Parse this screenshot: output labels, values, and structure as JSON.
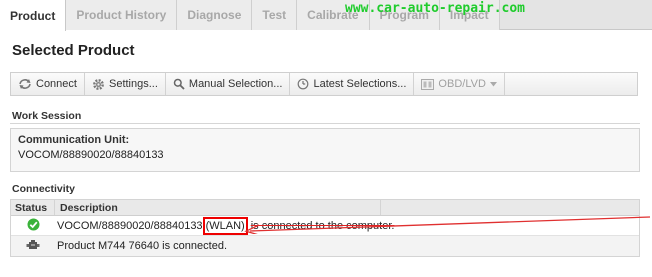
{
  "tabs": [
    {
      "label": "Product",
      "active": true
    },
    {
      "label": "Product History",
      "active": false
    },
    {
      "label": "Diagnose",
      "active": false
    },
    {
      "label": "Test",
      "active": false
    },
    {
      "label": "Calibrate",
      "active": false
    },
    {
      "label": "Program",
      "active": false
    },
    {
      "label": "Impact",
      "active": false
    }
  ],
  "watermark": "www.car-auto-repair.com",
  "page_title": "Selected Product",
  "toolbar": {
    "connect": "Connect",
    "settings": "Settings...",
    "manual_selection": "Manual Selection...",
    "latest_selections": "Latest Selections...",
    "obd": "OBD/LVD"
  },
  "work_session": {
    "label": "Work Session",
    "comm_unit_label": "Communication Unit:",
    "comm_unit_value": "VOCOM/88890020/88840133"
  },
  "connectivity": {
    "label": "Connectivity",
    "columns": {
      "status": "Status",
      "description": "Description"
    },
    "rows": [
      {
        "status_icon": "check-circle-icon",
        "desc_prefix": "VOCOM/88890020/88840133",
        "desc_highlight": "(WLAN)",
        "desc_suffix": "is connected to the computer."
      },
      {
        "status_icon": "engine-icon",
        "desc": "Product M744 76640 is connected."
      }
    ]
  },
  "colors": {
    "watermark": "#1fcc2c",
    "highlight_box": "#e00000",
    "arrow": "#e03030",
    "status_ok": "#33aa33"
  }
}
